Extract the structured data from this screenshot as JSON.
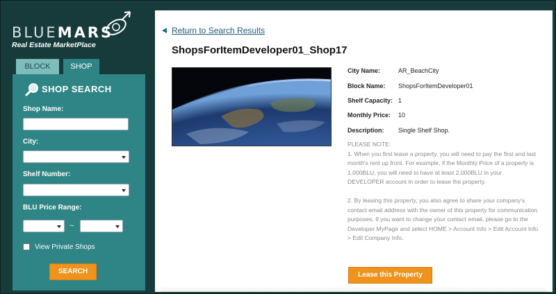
{
  "logo": {
    "word_thin": "BLUE",
    "word_bold": "MARS",
    "subtitle": "Real Estate MarketPlace"
  },
  "tabs": [
    {
      "label": "BLOCK",
      "active": false
    },
    {
      "label": "SHOP",
      "active": true
    }
  ],
  "search_panel": {
    "title": "SHOP SEARCH",
    "shop_name_label": "Shop Name:",
    "shop_name_value": "",
    "city_label": "City:",
    "city_value": "",
    "shelf_label": "Shelf Number:",
    "shelf_value": "",
    "price_label": "BLU Price Range:",
    "price_min": "",
    "price_max": "",
    "range_sep": "~",
    "private_label": "View Private Shops",
    "private_checked": false,
    "search_button": "SEARCH"
  },
  "detail": {
    "back_link": "Return to Search Results",
    "title": "ShopsForItemDeveloper01_Shop17",
    "fields": [
      {
        "label": "City Name:",
        "value": "AR_BeachCity"
      },
      {
        "label": "Block Name:",
        "value": "ShopsForItemDeveloper01"
      },
      {
        "label": "Shelf Capacity:",
        "value": "1"
      },
      {
        "label": "Monthly Price:",
        "value": "10"
      },
      {
        "label": "Description:",
        "value": "Single Shelf Shop."
      }
    ],
    "note_heading": "PLEASE NOTE:",
    "note_1": "1. When you first lease a property, you will need to pay the first and last month's rent up front. For example, if the Monthly Price of a property is 1,000BLU, you will need to have at least 2,000BLU in your DEVELOPER account in order to lease the property.",
    "note_2": "2. By leasing this property, you also agree to share your company's contact email address with the owner of this property for communication purposes. If you want to change your contact email, please go to the Developer MyPage and select HOME > Account Info > Edit Account Info > Edit Company Info.",
    "lease_button": "Lease this Property"
  },
  "colors": {
    "background": "#173a3a",
    "panel": "#2f8585",
    "accent": "#f0931d",
    "link": "#1e5a7a"
  }
}
